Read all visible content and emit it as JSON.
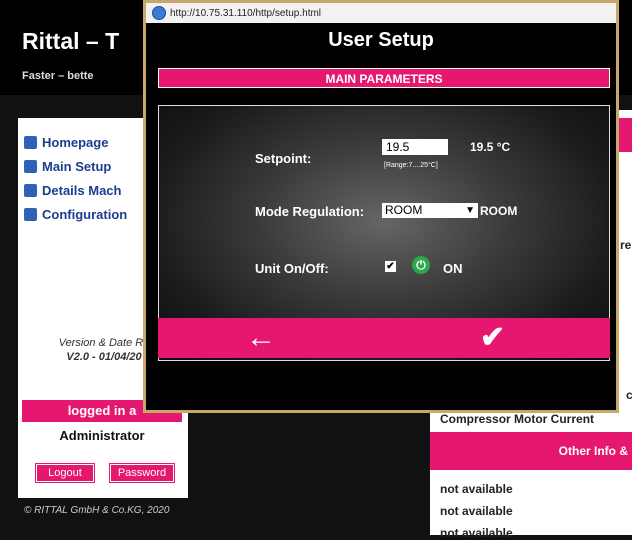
{
  "background": {
    "title": "Rittal – T",
    "slogan": "Faster – bette",
    "nav": [
      {
        "label": "Homepage",
        "icon": "home-icon"
      },
      {
        "label": "Main Setup",
        "icon": "setup-icon"
      },
      {
        "label": "Details Mach",
        "icon": "details-icon"
      },
      {
        "label": "Configuration",
        "icon": "configuration-icon"
      }
    ],
    "version_line1": "Version & Date Re",
    "version_line2": "V2.0 - 01/04/20",
    "logged_in": "logged in a",
    "user": "Administrator",
    "logout": "Logout",
    "password": "Password",
    "copyright": "© RITTAL GmbH & Co.KG, 2020",
    "right_panel": {
      "frag_re": "re",
      "frag_c": "c",
      "compressor": "Compressor Motor Current",
      "other_info": "Other Info &",
      "na1": "not available",
      "na2": "not available",
      "na3": "not available"
    }
  },
  "popup": {
    "url": "http://10.75.31.110/http/setup.html",
    "title": "User Setup",
    "section": "MAIN PARAMETERS",
    "setpoint_label": "Setpoint:",
    "setpoint_value": "19.5",
    "setpoint_display": "19.5 °C",
    "setpoint_range": "[Range:7....25°C]",
    "mode_label": "Mode Regulation:",
    "mode_selected": "ROOM",
    "mode_display": "ROOM",
    "unit_label": "Unit On/Off:",
    "unit_state": "ON",
    "back_symbol": "←",
    "ok_symbol": "✔"
  },
  "colors": {
    "accent": "#e6176e",
    "frame": "#c5a86a",
    "power": "#2aa84a"
  }
}
